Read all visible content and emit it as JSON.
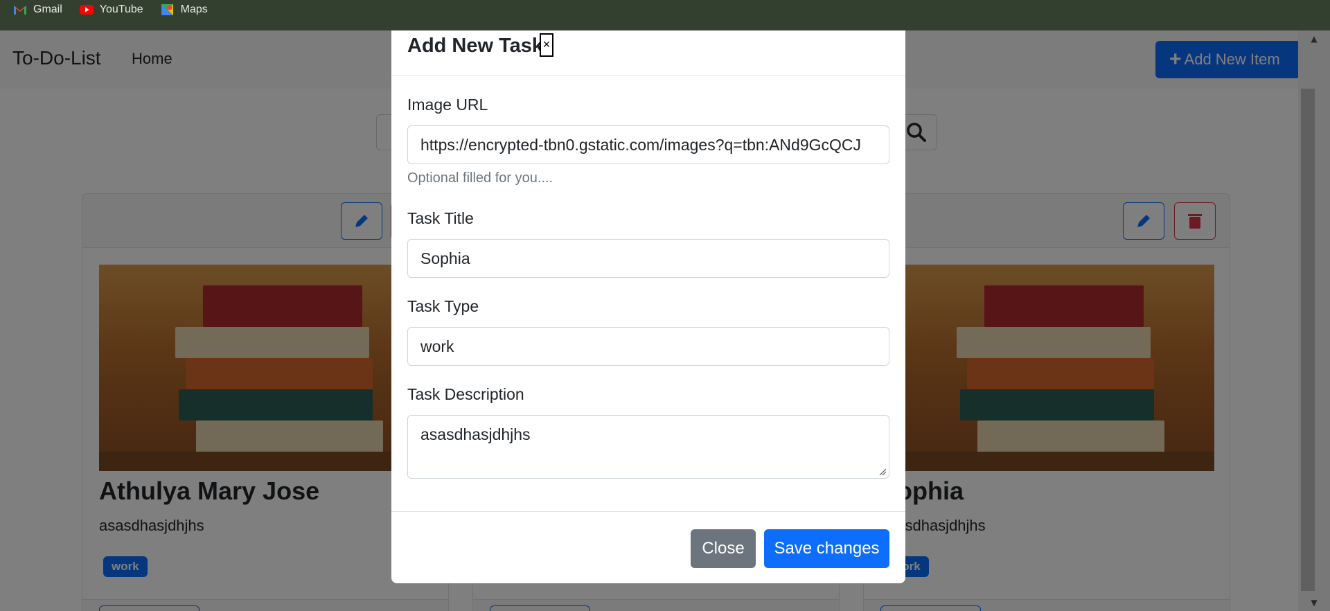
{
  "bookmarks": [
    {
      "label": "Gmail",
      "icon": "gmail-icon"
    },
    {
      "label": "YouTube",
      "icon": "youtube-icon"
    },
    {
      "label": "Maps",
      "icon": "maps-icon"
    }
  ],
  "navbar": {
    "brand": "To-Do-List",
    "home": "Home",
    "add_button": "Add New Item",
    "add_icon": "+"
  },
  "cards": [
    {
      "title": "Athulya Mary Jose",
      "description": "asasdhasjdhjhs",
      "type": "work"
    },
    {
      "title": "Sophia",
      "description": "asasdhasjdhjhs",
      "type": "work"
    }
  ],
  "modal": {
    "title": "Add New Task",
    "close_glyph": "×",
    "image_url_label": "Image URL",
    "image_url_value": "https://encrypted-tbn0.gstatic.com/images?q=tbn:ANd9GcQCJ",
    "image_url_help": "Optional filled for you....",
    "task_title_label": "Task Title",
    "task_title_value": "Sophia",
    "task_type_label": "Task Type",
    "task_type_value": "work",
    "task_description_label": "Task Description",
    "task_description_value": "asasdhasjdhjhs",
    "close_button": "Close",
    "save_button": "Save changes"
  },
  "colors": {
    "primary": "#0d6efd",
    "secondary": "#6c757d",
    "danger": "#dc3545",
    "bookmark_bar": "#34402f"
  }
}
